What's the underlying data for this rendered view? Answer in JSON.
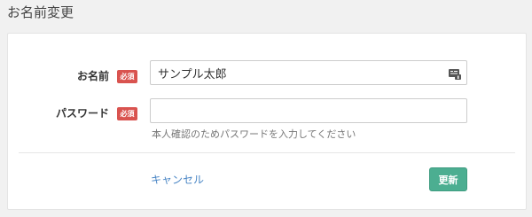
{
  "page": {
    "title": "お名前変更"
  },
  "form": {
    "name": {
      "label": "お名前",
      "required_badge": "必須",
      "value": "サンプル太郎",
      "icon": "contact-card-icon"
    },
    "password": {
      "label": "パスワード",
      "required_badge": "必須",
      "value": "",
      "placeholder": "",
      "help": "本人確認のためパスワードを入力してください"
    }
  },
  "actions": {
    "cancel_label": "キャンセル",
    "submit_label": "更新"
  },
  "colors": {
    "required_badge": "#d9534f",
    "submit_button": "#4cae91",
    "link": "#4a86c5",
    "background": "#f1f1f1"
  }
}
